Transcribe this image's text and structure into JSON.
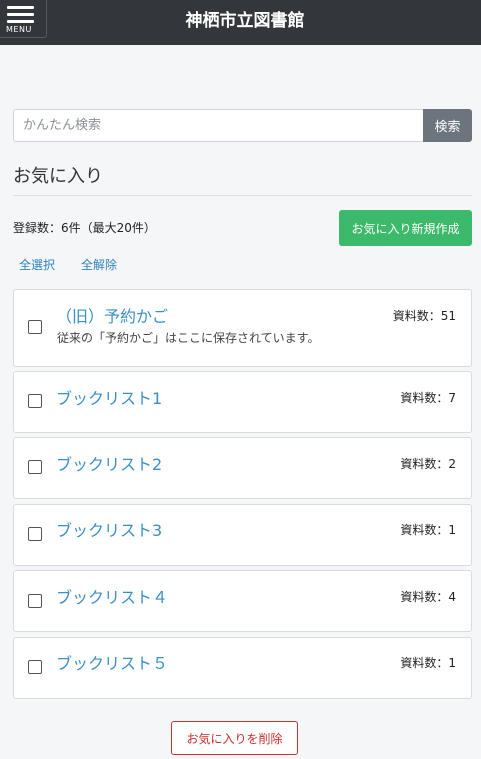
{
  "header": {
    "menu_label": "MENU",
    "title": "神栖市立図書館"
  },
  "search": {
    "placeholder": "かんたん検索",
    "value": "",
    "button_label": "検索"
  },
  "favorites": {
    "title": "お気に入り",
    "count_text": "登録数：6件（最大20件）",
    "new_button_label": "お気に入り新規作成",
    "select_all_label": "全選択",
    "clear_all_label": "全解除",
    "lists": [
      {
        "name": "（旧）予約かご",
        "description": "従来の「予約かご」はここに保存されています。",
        "count": "資料数：51"
      },
      {
        "name": "ブックリスト1",
        "count": "資料数：7"
      },
      {
        "name": "ブックリスト2",
        "count": "資料数：2"
      },
      {
        "name": "ブックリスト3",
        "count": "資料数：1"
      },
      {
        "name": "ブックリスト４",
        "count": "資料数：4"
      },
      {
        "name": "ブックリスト５",
        "count": "資料数：1"
      }
    ],
    "delete_button_label": "お気に入りを削除"
  },
  "colors": {
    "header_bg": "#33373c",
    "primary_link": "#3a8fc8",
    "success": "#3cb96a",
    "danger": "#c9302c",
    "secondary": "#6c757d"
  }
}
